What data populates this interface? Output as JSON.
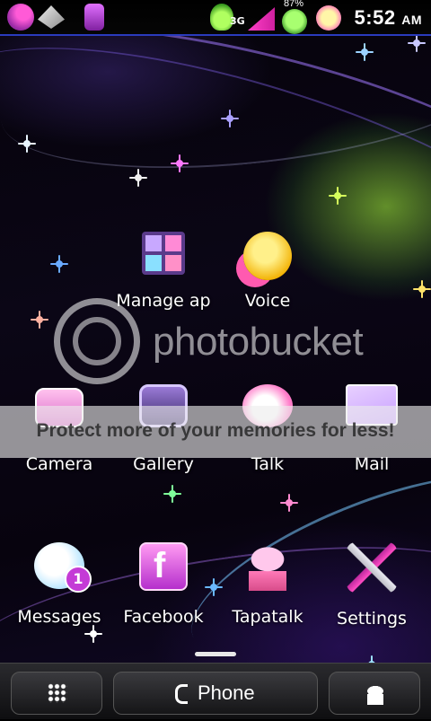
{
  "status_bar": {
    "network": "3G",
    "battery_percent": "87%",
    "time": "5:52",
    "ampm": "AM"
  },
  "home": {
    "rows": [
      [
        {
          "label": "Manage ap",
          "icon": "manage-apps-icon"
        },
        {
          "label": "Voice",
          "icon": "voice-emoji-icon"
        }
      ],
      [
        {
          "label": "Camera",
          "icon": "camera-icon"
        },
        {
          "label": "Gallery",
          "icon": "gallery-icon"
        },
        {
          "label": "Talk",
          "icon": "talk-bubble-icon"
        },
        {
          "label": "Mail",
          "icon": "mail-envelope-icon"
        }
      ],
      [
        {
          "label": "Messages",
          "icon": "messages-icon",
          "badge": "1"
        },
        {
          "label": "Facebook",
          "icon": "facebook-icon"
        },
        {
          "label": "Tapatalk",
          "icon": "tapatalk-cupcake-icon"
        },
        {
          "label": "Settings",
          "icon": "settings-tools-icon"
        }
      ]
    ]
  },
  "watermark": {
    "brand": "photobucket",
    "banner": "Protect more of your memories for less!"
  },
  "dock": {
    "phone_label": "Phone"
  },
  "colors": {
    "accent": "#c43bd6",
    "status_border": "#2a3bbd"
  }
}
